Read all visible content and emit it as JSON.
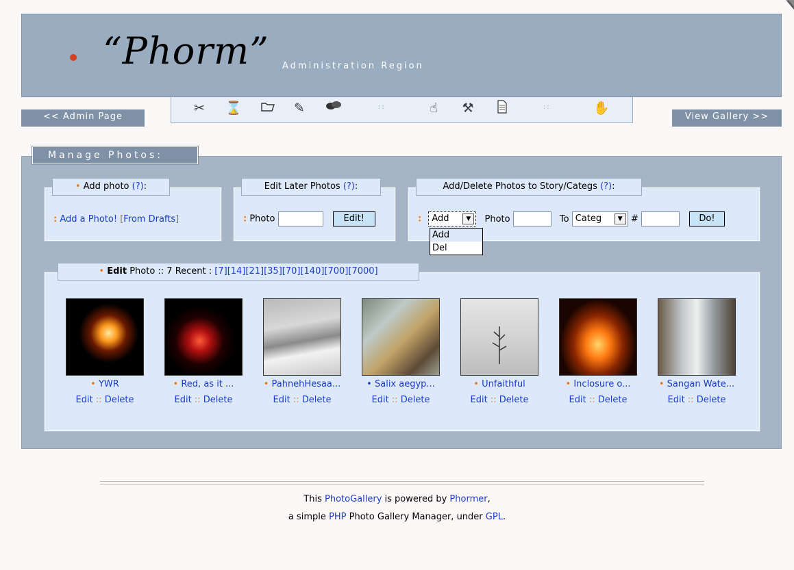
{
  "header": {
    "logo": "“Phorm”",
    "subtitle": "Administration Region"
  },
  "nav": {
    "admin_page": "<< Admin Page",
    "view_gallery": "View Gallery >>",
    "toolbar_icons": [
      "scissors-icon",
      "hourglass-icon",
      "folder-icon",
      "edit-icon",
      "comments-icon",
      "hand-pointer-icon",
      "tools-icon",
      "document-icon",
      "waving-hand-icon"
    ]
  },
  "manage": {
    "title": "Manage Photos:"
  },
  "add_photo": {
    "title_label": "Add photo",
    "help": "(?)",
    "suffix": ":",
    "add_link": "Add a Photo!",
    "drafts_link": "From Drafts"
  },
  "edit_later": {
    "title_label": "Edit Later Photos",
    "help": "(?)",
    "suffix": ":",
    "photo_label": "Photo",
    "photo_value": "",
    "button": "Edit!"
  },
  "story": {
    "title_label": "Add/Delete Photos to Story/Categs",
    "help": "(?)",
    "suffix": ":",
    "action_selected": "Add",
    "action_options": [
      "Add",
      "Del"
    ],
    "photo_label": "Photo",
    "to_label": "To",
    "target_selected": "Categ",
    "hash_label": "#",
    "button": "Do!"
  },
  "recent": {
    "edit_label": "Edit",
    "text": "Photo :: 7 Recent :",
    "links": [
      "[7]",
      "[14]",
      "[21]",
      "[35]",
      "[70]",
      "[140]",
      "[700]",
      "[7000]"
    ],
    "photos": [
      {
        "title": "YWR",
        "bullet": "orange"
      },
      {
        "title": "Red, as it ...",
        "bullet": "orange"
      },
      {
        "title": "PahnehHesaa...",
        "bullet": "orange"
      },
      {
        "title": "Salix aegyp...",
        "bullet": "blue"
      },
      {
        "title": "Unfaithful",
        "bullet": "orange"
      },
      {
        "title": "Inclosure o...",
        "bullet": "orange"
      },
      {
        "title": "Sangan Wate...",
        "bullet": "orange"
      }
    ],
    "edit_op": "Edit",
    "sep": "::",
    "delete_op": "Delete"
  },
  "footer": {
    "line1_a": "This",
    "line1_link1": "PhotoGallery",
    "line1_b": "is powered by",
    "line1_link2": "Phormer",
    "line1_c": ",",
    "line2_a": "a simple",
    "line2_link1": "PHP",
    "line2_b": "Photo Gallery Manager, under",
    "line2_link2": "GPL",
    "line2_c": "."
  }
}
